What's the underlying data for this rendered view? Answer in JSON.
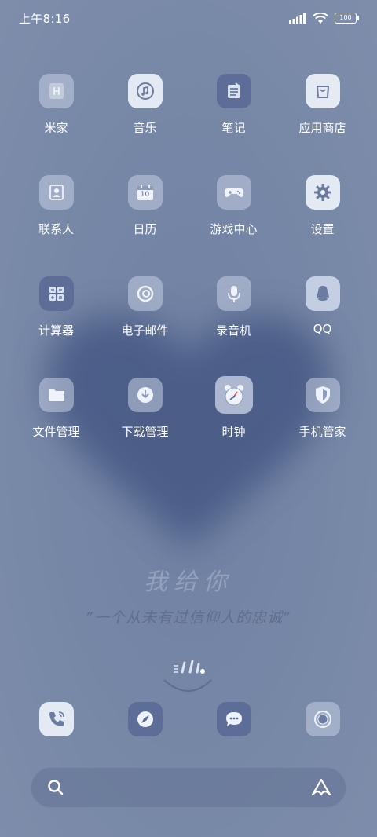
{
  "status_bar": {
    "time": "上午8:16",
    "battery": "100",
    "icons": [
      "signal-icon",
      "wifi-icon",
      "battery-icon"
    ]
  },
  "apps": [
    {
      "label": "米家",
      "icon": "mijia-icon"
    },
    {
      "label": "音乐",
      "icon": "music-icon"
    },
    {
      "label": "笔记",
      "icon": "notes-icon"
    },
    {
      "label": "应用商店",
      "icon": "app-store-icon"
    },
    {
      "label": "联系人",
      "icon": "contacts-icon"
    },
    {
      "label": "日历",
      "icon": "calendar-icon",
      "badge": "10"
    },
    {
      "label": "游戏中心",
      "icon": "gamepad-icon"
    },
    {
      "label": "设置",
      "icon": "gear-icon"
    },
    {
      "label": "计算器",
      "icon": "calculator-icon"
    },
    {
      "label": "电子邮件",
      "icon": "email-icon"
    },
    {
      "label": "录音机",
      "icon": "microphone-icon"
    },
    {
      "label": "QQ",
      "icon": "qq-penguin-icon"
    },
    {
      "label": "文件管理",
      "icon": "folder-icon"
    },
    {
      "label": "下载管理",
      "icon": "download-icon"
    },
    {
      "label": "时钟",
      "icon": "alarm-clock-icon"
    },
    {
      "label": "手机管家",
      "icon": "shield-icon"
    }
  ],
  "wallpaper_text": {
    "line1": "我给你",
    "line2": "“一个从未有过信仰人的忠诚”"
  },
  "dock": [
    {
      "name": "phone",
      "icon": "phone-icon"
    },
    {
      "name": "browser",
      "icon": "compass-icon"
    },
    {
      "name": "messages",
      "icon": "chat-bubble-icon"
    },
    {
      "name": "camera",
      "icon": "camera-icon"
    }
  ],
  "search": {
    "placeholder": "",
    "icons": [
      "search-icon",
      "assistant-icon"
    ]
  },
  "colors": {
    "background": "#7a8aa8",
    "heart": "#4a5b86",
    "icon_light": "#eef2fa",
    "icon_dark": "#58689"
  }
}
